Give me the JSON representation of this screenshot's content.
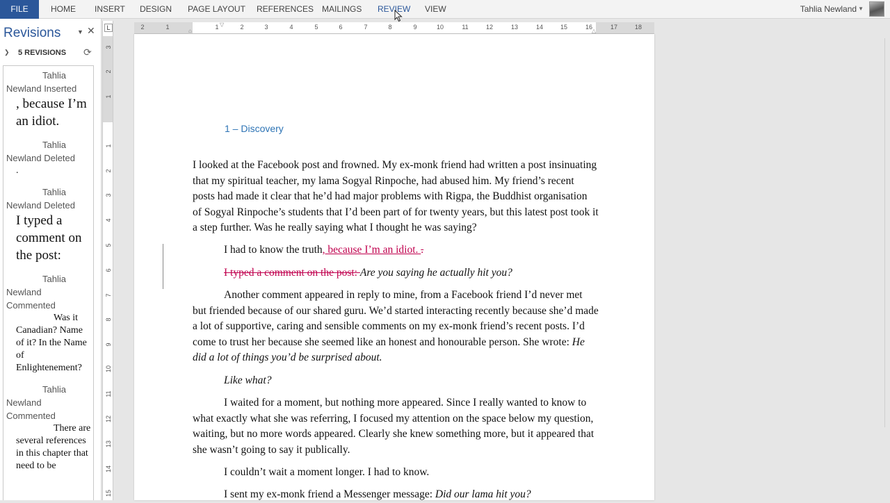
{
  "ribbon": {
    "file": "FILE",
    "tabs": [
      "HOME",
      "INSERT",
      "DESIGN",
      "PAGE LAYOUT",
      "REFERENCES",
      "MAILINGS",
      "REVIEW",
      "VIEW"
    ],
    "active_tab": "REVIEW",
    "user": "Tahlia Newland",
    "accent": "#2b579a"
  },
  "revisions_pane": {
    "title": "Revisions",
    "count": "5 REVISIONS",
    "items": [
      {
        "author": "Tahlia Newland Inserted",
        "text": ", because I’m an idiot."
      },
      {
        "author": "Tahlia Newland Deleted",
        "text": "."
      },
      {
        "author": "Tahlia Newland Deleted",
        "text": "I typed a comment on the post:"
      },
      {
        "author": "Tahlia Newland Commented",
        "text": "Was it Canadian? Name of it? In the Name of Enlightenement?"
      },
      {
        "author": "Tahlia Newland Commented",
        "text": "There are several references in this chapter that need to be"
      }
    ]
  },
  "ruler": {
    "h_ticks": [
      "2",
      "1",
      "1",
      "2",
      "3",
      "4",
      "5",
      "6",
      "7",
      "8",
      "9",
      "10",
      "11",
      "12",
      "13",
      "14",
      "15",
      "16",
      "17",
      "18"
    ],
    "v_ticks": [
      "3",
      "2",
      "1",
      "1",
      "2",
      "3",
      "4",
      "5",
      "6",
      "7",
      "8",
      "9",
      "10",
      "11",
      "12",
      "13",
      "14",
      "15"
    ],
    "tab_selector": "L"
  },
  "document": {
    "heading": "1 – Discovery",
    "p1": "I looked at the Facebook post and frowned. My ex-monk friend had written a post insinuating that my spiritual teacher, my lama Sogyal Rinpoche, had abused him. My friend’s recent posts had made it clear that he’d had major problems with Rigpa, the Buddhist organisation of Sogyal Rinpoche’s students that I’d been part of for twenty years, but this latest post took it a step further. Was he really saying what I thought he was saying?",
    "p2_start": "I had to know the truth",
    "p2_inserted": ", because I’m an idiot. ",
    "p2_deleted": ".",
    "p3_deleted": "I typed a comment on the post: ",
    "p3_italic": "Are you saying he actually hit you?",
    "p4_text": "Another comment appeared in reply to mine, from a Facebook friend I’d never met but friended because of our shared guru. We’d started interacting recently because she’d made a lot of supportive, caring and sensible comments on my ex-monk friend’s recent posts. I’d come to trust her because she seemed like an honest and honourable person. She wrote: ",
    "p4_italic": "He did a lot of things you’d be surprised about.",
    "p5_italic": "Like what?",
    "p6": "I waited for a moment, but nothing more appeared. Since I really wanted to know to what exactly what she was referring, I focused my attention on the space below my question, waiting, but no more words appeared. Clearly she knew something more, but it appeared that she wasn’t going to say it publically.",
    "p7": "I couldn’t wait a moment longer. I had to know.",
    "p8_text": "I sent my ex-monk friend a Messenger message: ",
    "p8_italic": "Did our lama hit you?",
    "revision_color": "#c0004e",
    "heading_color": "#2e74b5"
  }
}
